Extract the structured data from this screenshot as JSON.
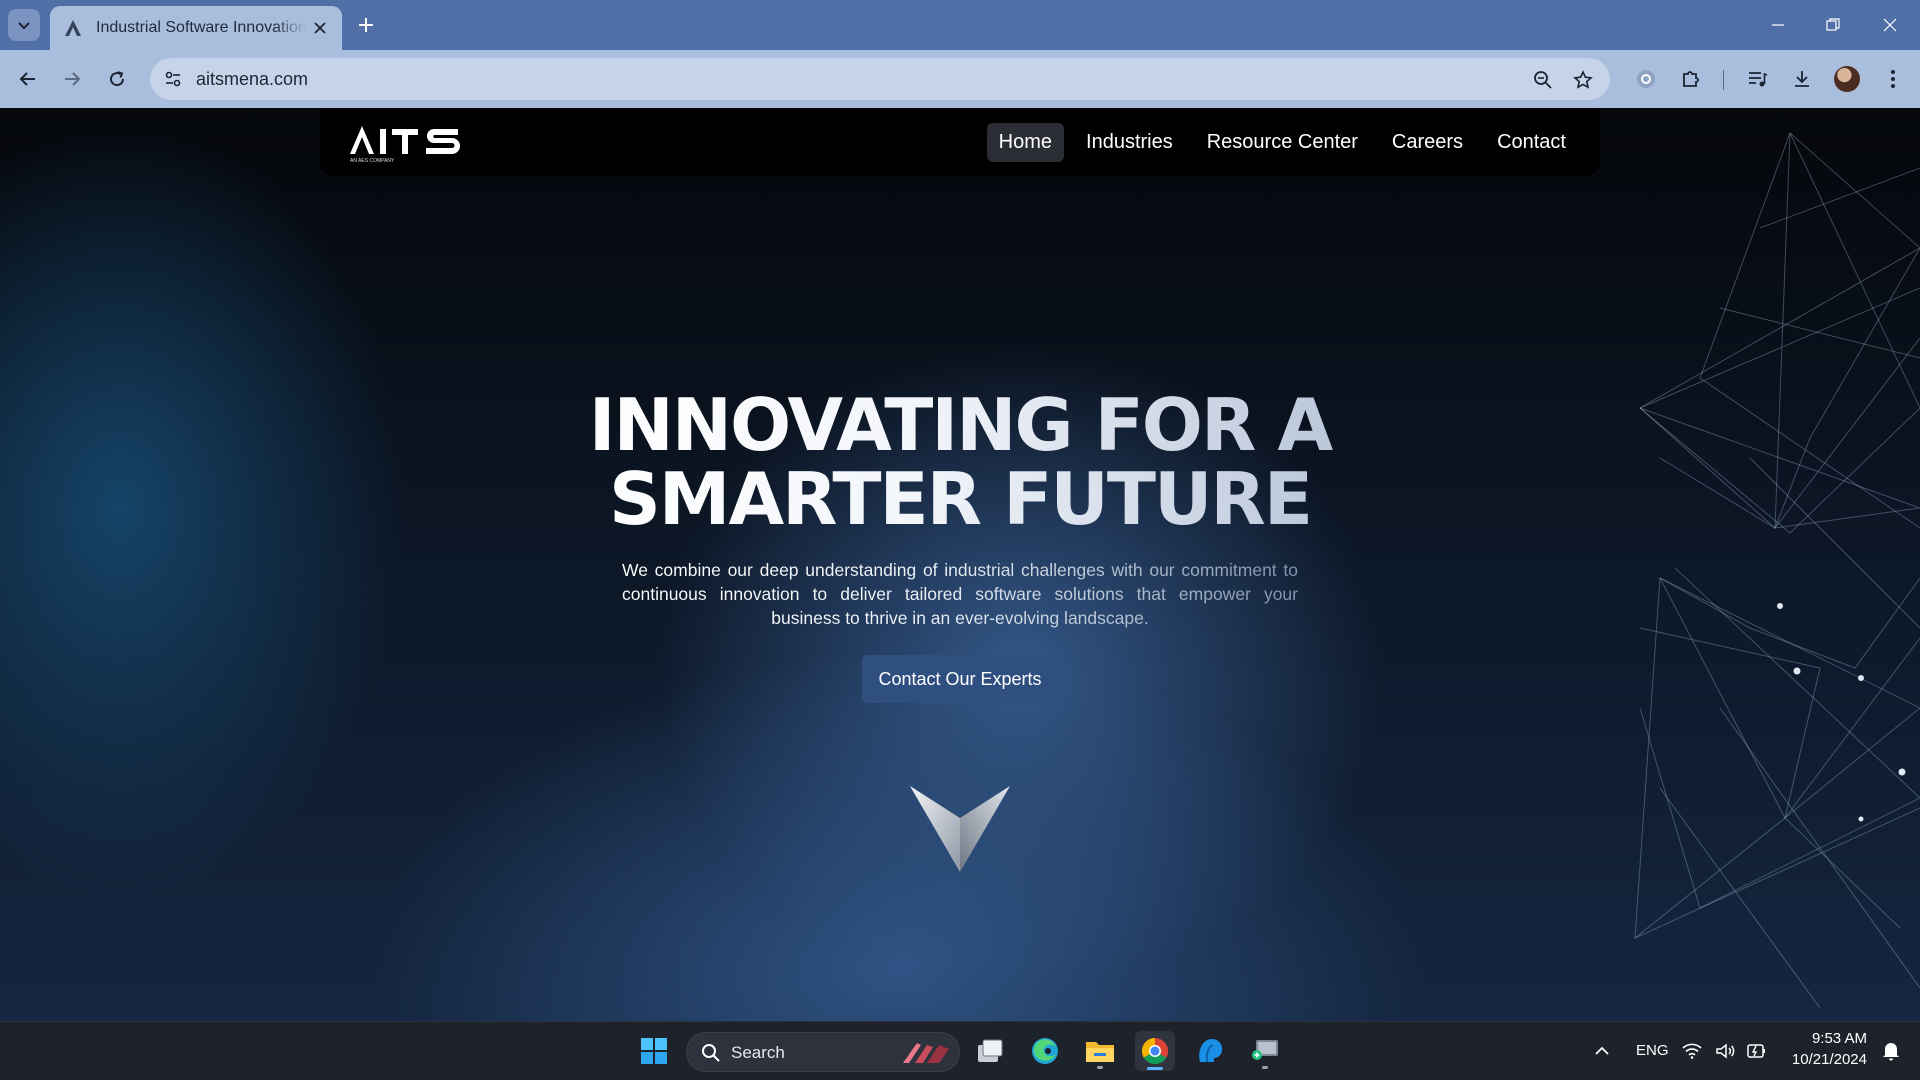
{
  "browser": {
    "tab_title": "Industrial Software Innovation |",
    "url": "aitsmena.com"
  },
  "site": {
    "logo_text": "AITS",
    "logo_subtext": "AN AES COMPANY",
    "nav": [
      {
        "label": "Home",
        "active": true
      },
      {
        "label": "Industries",
        "active": false
      },
      {
        "label": "Resource Center",
        "active": false
      },
      {
        "label": "Careers",
        "active": false
      },
      {
        "label": "Contact",
        "active": false
      }
    ],
    "hero": {
      "title_line1": "INNOVATING FOR A",
      "title_line2": "SMARTER FUTURE",
      "subtitle": "We combine our deep understanding of industrial challenges with our commitment to continuous innovation to deliver tailored software solutions that empower your business to thrive in an ever-evolving landscape.",
      "cta_label": "Contact Our Experts"
    }
  },
  "taskbar": {
    "search_placeholder": "Search",
    "language": "ENG",
    "time": "9:53 AM",
    "date": "10/21/2024"
  },
  "colors": {
    "tab_bar": "#4f6fa6",
    "toolbar": "#a9bddd",
    "cta": "#2e4f80",
    "taskbar": "#1e222b"
  },
  "icons": [
    "tab-list-icon",
    "site-favicon",
    "close-icon",
    "plus-icon",
    "minimize-icon",
    "restore-icon",
    "window-close-icon",
    "back-icon",
    "forward-icon",
    "reload-icon",
    "site-info-icon",
    "zoom-icon",
    "star-icon",
    "extension-circle-icon",
    "puzzle-icon",
    "media-icon",
    "download-icon",
    "windows-start-icon",
    "search-icon",
    "task-view-icon",
    "edge-icon",
    "file-explorer-icon",
    "chrome-icon",
    "app-icon",
    "app-remote-icon",
    "chevron-up-icon",
    "wifi-icon",
    "volume-icon",
    "battery-icon",
    "bell-icon"
  ]
}
